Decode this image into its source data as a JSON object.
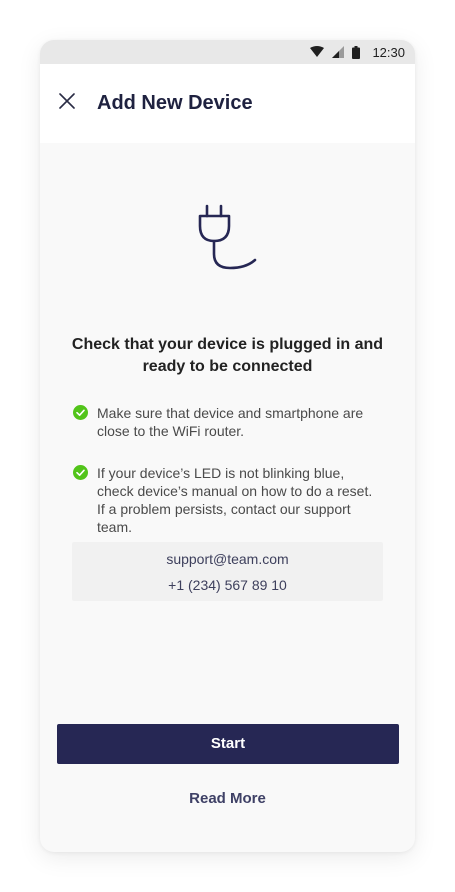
{
  "status_bar": {
    "time": "12:30",
    "icons": [
      "wifi-icon",
      "signal-icon",
      "battery-icon"
    ]
  },
  "header": {
    "title": "Add New Device",
    "close_icon": "close-icon"
  },
  "hero": {
    "icon": "plug-icon"
  },
  "main": {
    "heading": "Check that your device is plugged in and ready to be connected",
    "tips": [
      {
        "icon": "check-circle-icon",
        "text": "Make sure that device and smartphone are close to the WiFi router."
      },
      {
        "icon": "check-circle-icon",
        "text": "If your device’s LED is not blinking blue, check device’s manual on how to do a reset. If a problem persists, contact our support team."
      }
    ],
    "contact": {
      "email": "support@team.com",
      "phone": "+1 (234) 567 89 10"
    }
  },
  "actions": {
    "start_label": "Start",
    "read_more_label": "Read More"
  },
  "colors": {
    "primary": "#262754",
    "success": "#52c41a",
    "title": "#1f2240"
  }
}
